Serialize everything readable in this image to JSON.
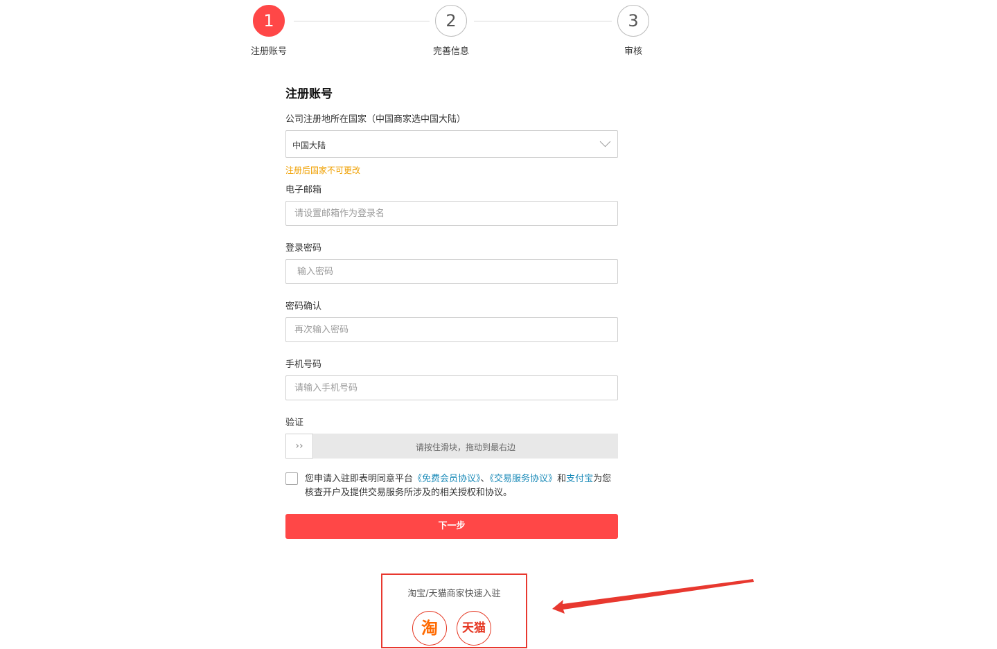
{
  "steps": [
    {
      "number": "1",
      "label": "注册账号",
      "active": true
    },
    {
      "number": "2",
      "label": "完善信息",
      "active": false
    },
    {
      "number": "3",
      "label": "审核",
      "active": false
    }
  ],
  "form": {
    "title": "注册账号",
    "country": {
      "label": "公司注册地所在国家（中国商家选中国大陆）",
      "value": "中国大陆",
      "hint": "注册后国家不可更改"
    },
    "email": {
      "label": "电子邮箱",
      "placeholder": "请设置邮箱作为登录名"
    },
    "password": {
      "label": "登录密码",
      "placeholder": "输入密码"
    },
    "confirm": {
      "label": "密码确认",
      "placeholder": "再次输入密码"
    },
    "phone": {
      "label": "手机号码",
      "placeholder": "请输入手机号码"
    },
    "verify": {
      "label": "验证",
      "handle_icon": "double-chevron-right-icon",
      "handle_glyph": "››",
      "text": "请按住滑块，拖动到最右边"
    },
    "agreement": {
      "prefix": "您申请入驻即表明同意平台",
      "link1": "《免费会员协议》",
      "sep": "、",
      "link2": "《交易服务协议》",
      "and": "和",
      "link3": "支付宝",
      "suffix": "为您核查开户及提供交易服务所涉及的相关授权和协议。"
    },
    "next_label": "下一步"
  },
  "quick_entry": {
    "title": "淘宝/天猫商家快速入驻",
    "taobao_label": "淘",
    "tmall_label": "天猫"
  },
  "colors": {
    "accent": "#ff4747",
    "link": "#1a8ab8",
    "hint": "#f0a000",
    "annotation": "#e8382f"
  }
}
